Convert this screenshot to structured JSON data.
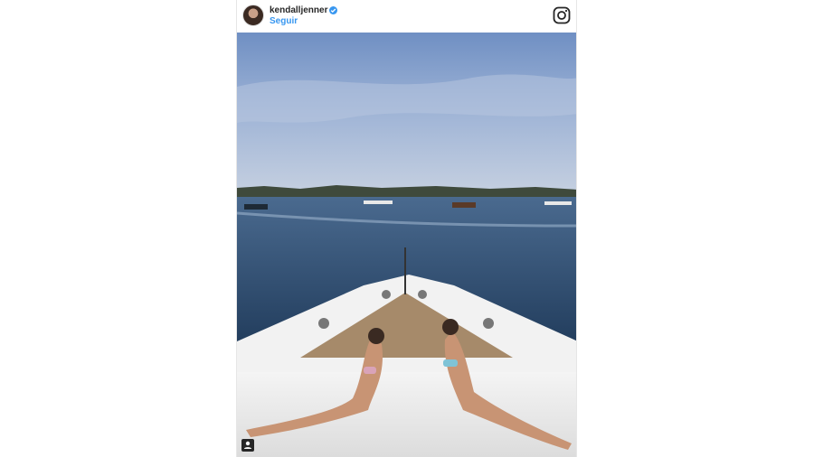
{
  "post": {
    "username": "kendalljenner",
    "follow_label": "Seguir"
  },
  "icons": {
    "avatar": "profile-avatar",
    "verified": "verified-badge-icon",
    "instagram": "instagram-logo-icon",
    "tagged_people": "user-tag-icon"
  },
  "colors": {
    "link_blue": "#3897f0",
    "text_dark": "#262626"
  }
}
